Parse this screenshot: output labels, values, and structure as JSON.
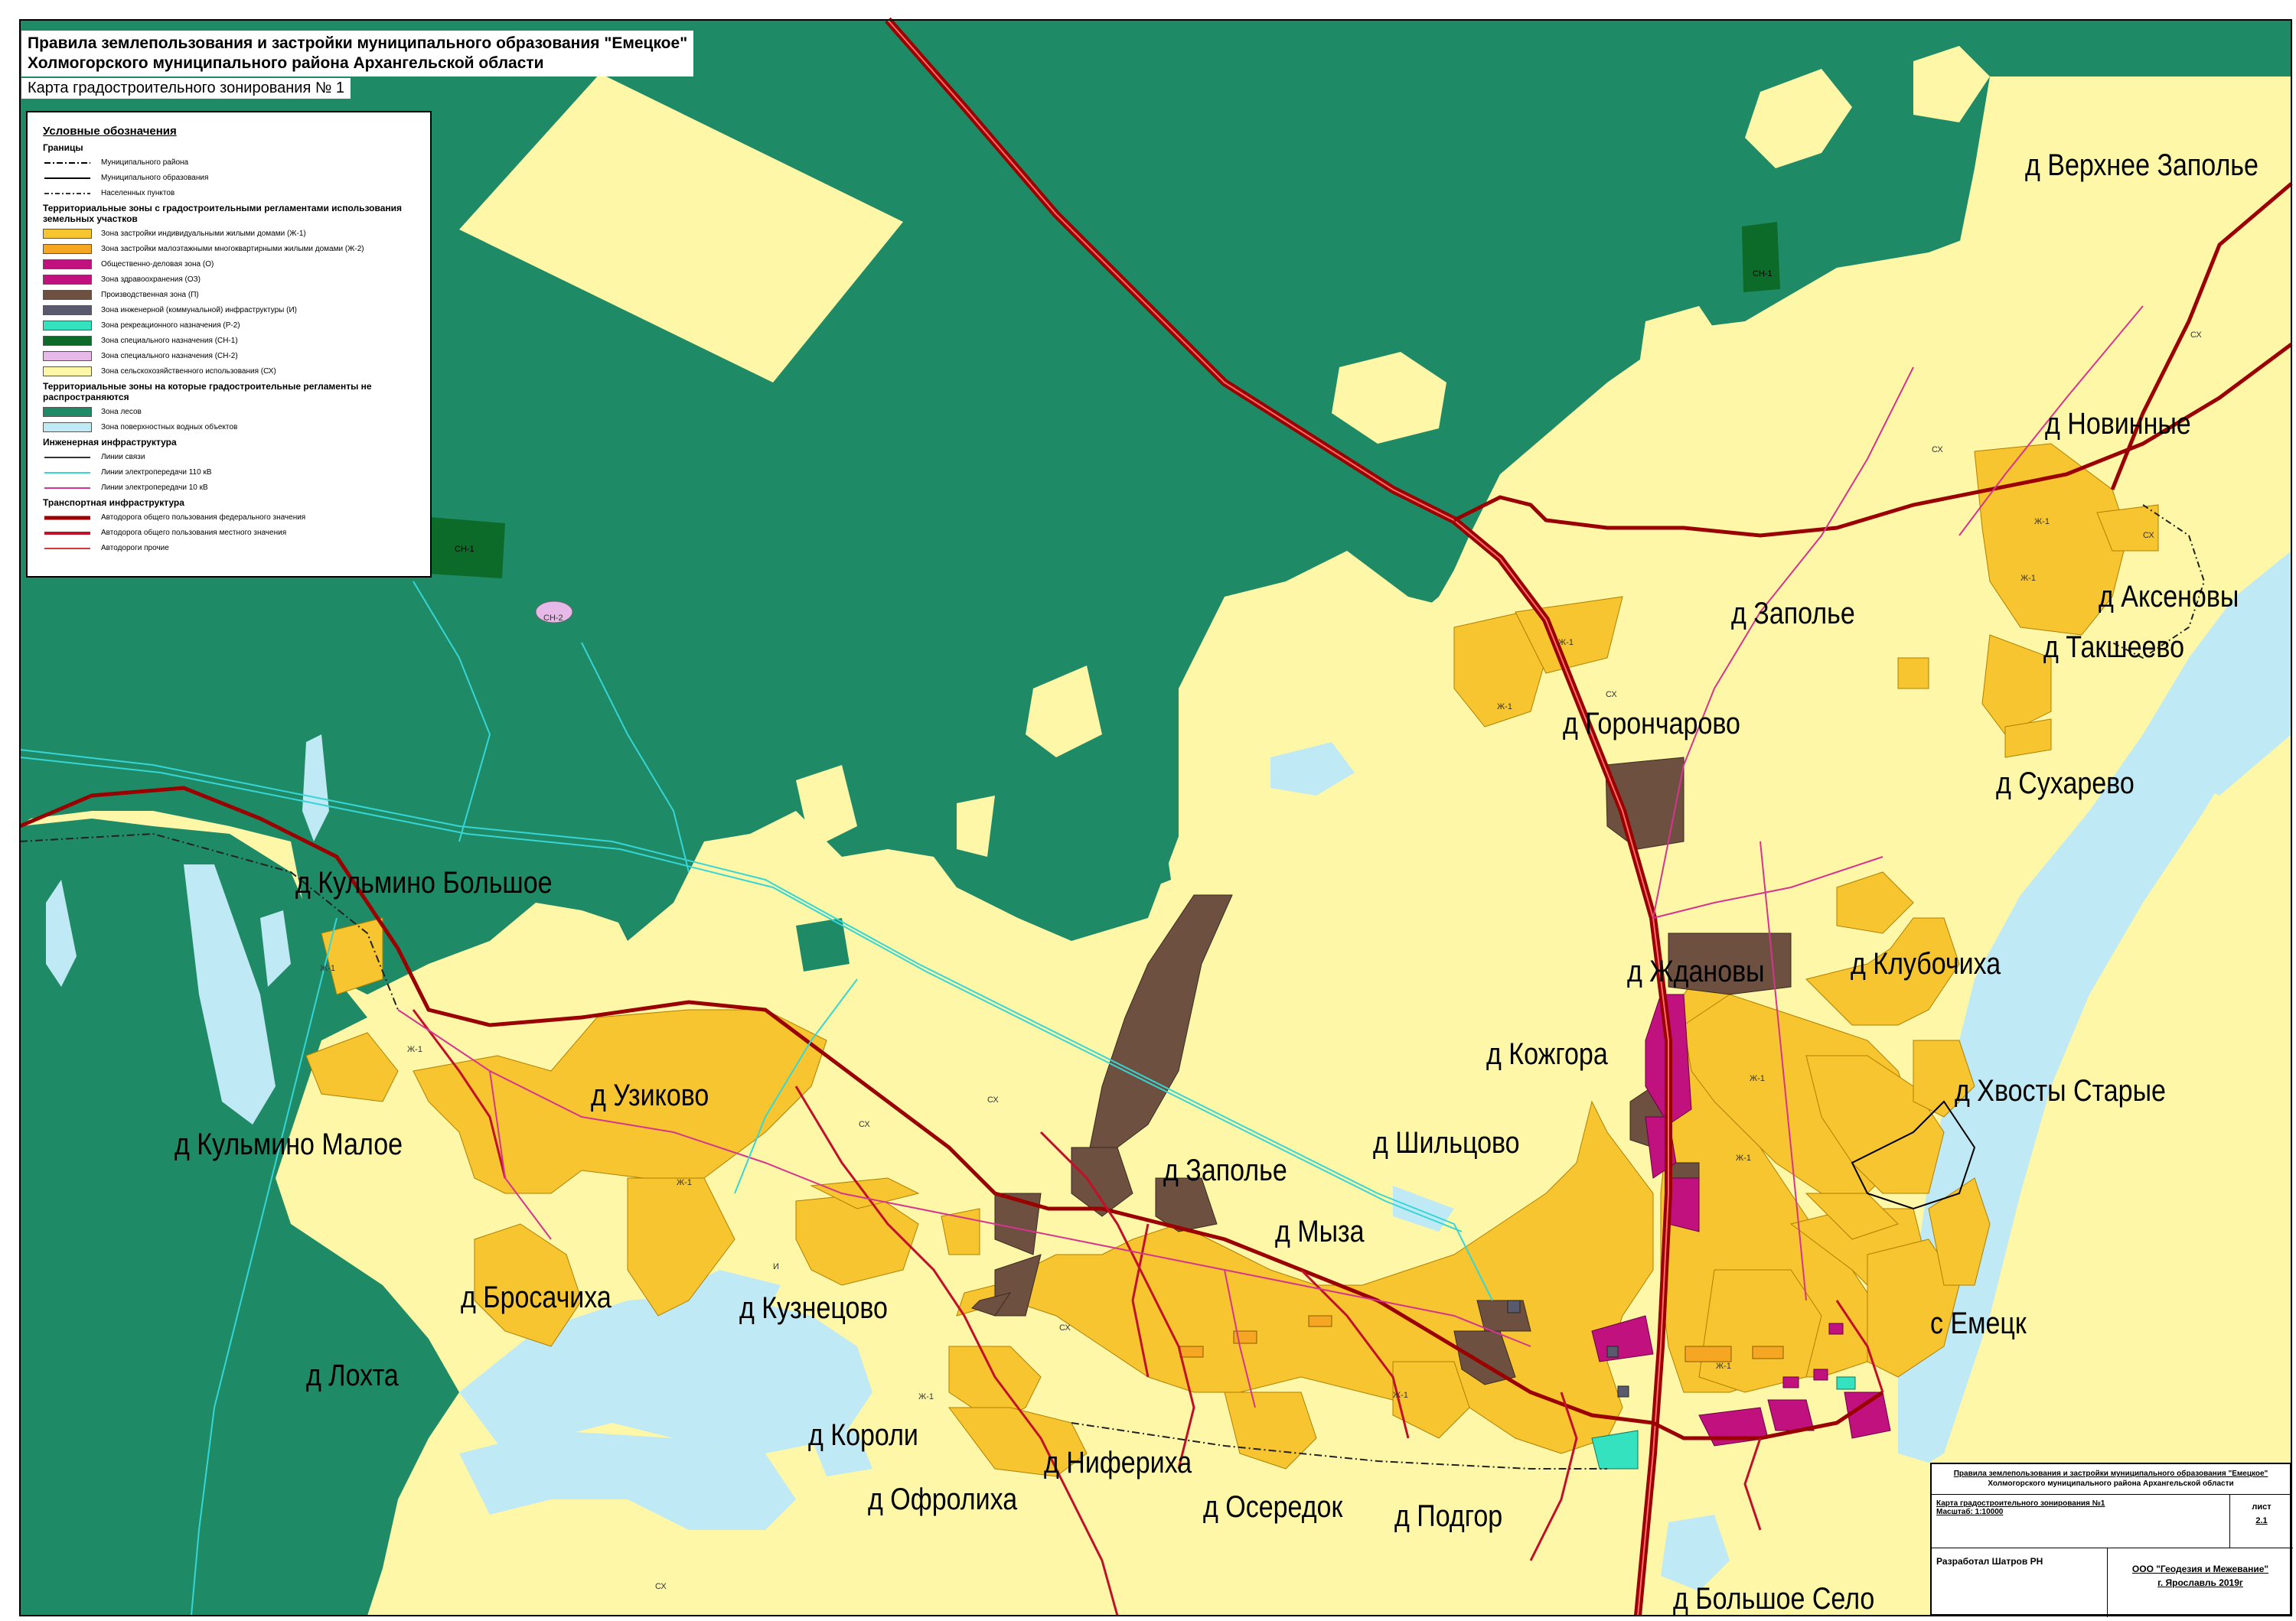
{
  "title": {
    "line1": "Правила землепользования и застройки муниципального образования \"Емецкое\"",
    "line2": "Холмогорского муниципального района Архангельской области"
  },
  "subtitle": "Карта градостроительного зонирования № 1",
  "legend": {
    "heading": "Условные обозначения",
    "borders_title": "Границы",
    "borders": [
      {
        "label": "Муниципального района",
        "style": "dashdot",
        "color": "#000000"
      },
      {
        "label": "Муниципального образования",
        "style": "solid",
        "color": "#000000"
      },
      {
        "label": "Населенных пунктов",
        "style": "dashdot-thin",
        "color": "#333333"
      }
    ],
    "zones_title": "Территориальные зоны с градостроительными регламентами использования земельных участков",
    "zones": [
      {
        "label": "Зона застройки индивидуальными жилыми домами  (Ж-1)",
        "color": "#f7c52f"
      },
      {
        "label": "Зона застройки малоэтажными многоквартирными жилыми домами (Ж-2)",
        "color": "#f5a623"
      },
      {
        "label": "Общественно-деловая зона (О)",
        "color": "#c0117f"
      },
      {
        "label": "Зона здравоохранения (ОЗ)",
        "color": "#c0117f"
      },
      {
        "label": "Производственная зона (П)",
        "color": "#6e5040"
      },
      {
        "label": "Зона инженерной (коммунальной) инфраструктуры (И)",
        "color": "#5a5a6e"
      },
      {
        "label": "Зона рекреационного назначения (Р-2)",
        "color": "#34e2c0"
      },
      {
        "label": "Зона специального назначения (СН-1)",
        "color": "#0d6b2a"
      },
      {
        "label": "Зона специального назначения (СН-2)",
        "color": "#e7b9e8"
      },
      {
        "label": "Зона сельскохозяйственного использования (СХ)",
        "color": "#fff7a8"
      }
    ],
    "nozones_title": "Территориальные зоны на которые градостроительные регламенты не распространяются",
    "nozones": [
      {
        "label": "Зона лесов",
        "color": "#1e8a66"
      },
      {
        "label": "Зона поверхностных водных объектов",
        "color": "#bfe9f5"
      }
    ],
    "eng_title": "Инженерная инфраструктура",
    "eng": [
      {
        "label": "Линии связи",
        "color": "#333333"
      },
      {
        "label": "Линии электропередачи 110 кВ",
        "color": "#36d6d6"
      },
      {
        "label": "Линии электропередачи 10 кВ",
        "color": "#d6358f"
      }
    ],
    "transport_title": "Транспортная инфраструктура",
    "transport": [
      {
        "label": "Автодорога общего пользования федерального значения",
        "color": "#9a0000"
      },
      {
        "label": "Автодорога общего пользования местного значения",
        "color": "#c0102a"
      },
      {
        "label": "Автодороги прочие",
        "color": "#d23a3a"
      }
    ]
  },
  "places": [
    "д Верхнее Заполье",
    "д Новинные",
    "д Аксеновы",
    "д Такшеево",
    "д Заполье",
    "д Горончарово",
    "д Сухарево",
    "д Кульмино Большое",
    "д Ждановы",
    "д Клубочиха",
    "д Кожгора",
    "д Хвосты Старые",
    "д Узиково",
    "д Шильцово",
    "д Кульмино Малое",
    "д Заполье",
    "д Мыза",
    "д Бросачиха",
    "д Кузнецово",
    "с Емецк",
    "д Лохта",
    "д Короли",
    "д Нифериха",
    "д Офролиха",
    "д Осередок",
    "д Подгор",
    "д Большое Село"
  ],
  "zone_codes": {
    "sx": "СХ",
    "zh1": "Ж-1",
    "sn1": "СН-1",
    "sn2": "СН-2",
    "i": "И"
  },
  "stamp": {
    "title1": "Правила землепользования и застройки муниципального образования \"Емецкое\"",
    "title2": "Холмогорского муниципального района Архангельской области",
    "map_name": "Карта градостроительного зонирования №1",
    "scale": "Масштаб: 1:10000",
    "sheet_label": "лист",
    "sheet_no": "2.1",
    "author": "Разработал  Шатров РН",
    "org": "ООО \"Геодезия и Межевание\"",
    "city_year": "г. Ярославль 2019г"
  },
  "colors": {
    "forest": "#1e8a66",
    "agri": "#fff7a8",
    "residential": "#f7c52f",
    "water": "#bfe9f5",
    "industrial": "#6e5040",
    "public": "#c0117f"
  }
}
